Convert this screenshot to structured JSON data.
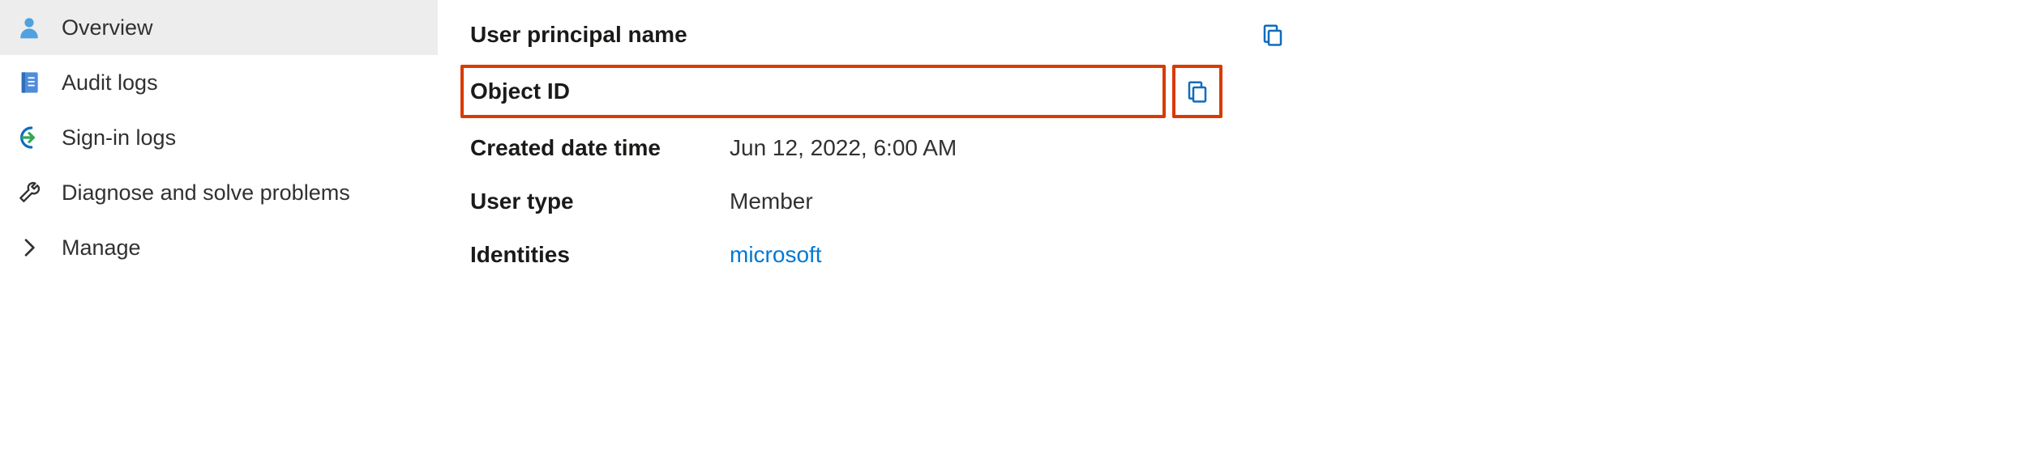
{
  "sidebar": {
    "items": [
      {
        "label": "Overview"
      },
      {
        "label": "Audit logs"
      },
      {
        "label": "Sign-in logs"
      },
      {
        "label": "Diagnose and solve problems"
      },
      {
        "label": "Manage"
      }
    ]
  },
  "colors": {
    "highlight": "#d83b01",
    "link": "#0078d4",
    "icon": "#0f6cbd"
  },
  "fields": {
    "upn": {
      "label": "User principal name",
      "value": ""
    },
    "object_id": {
      "label": "Object ID",
      "value": ""
    },
    "created": {
      "label": "Created date time",
      "value": "Jun 12, 2022, 6:00 AM"
    },
    "user_type": {
      "label": "User type",
      "value": "Member"
    },
    "identities": {
      "label": "Identities",
      "value": "microsoft"
    }
  }
}
